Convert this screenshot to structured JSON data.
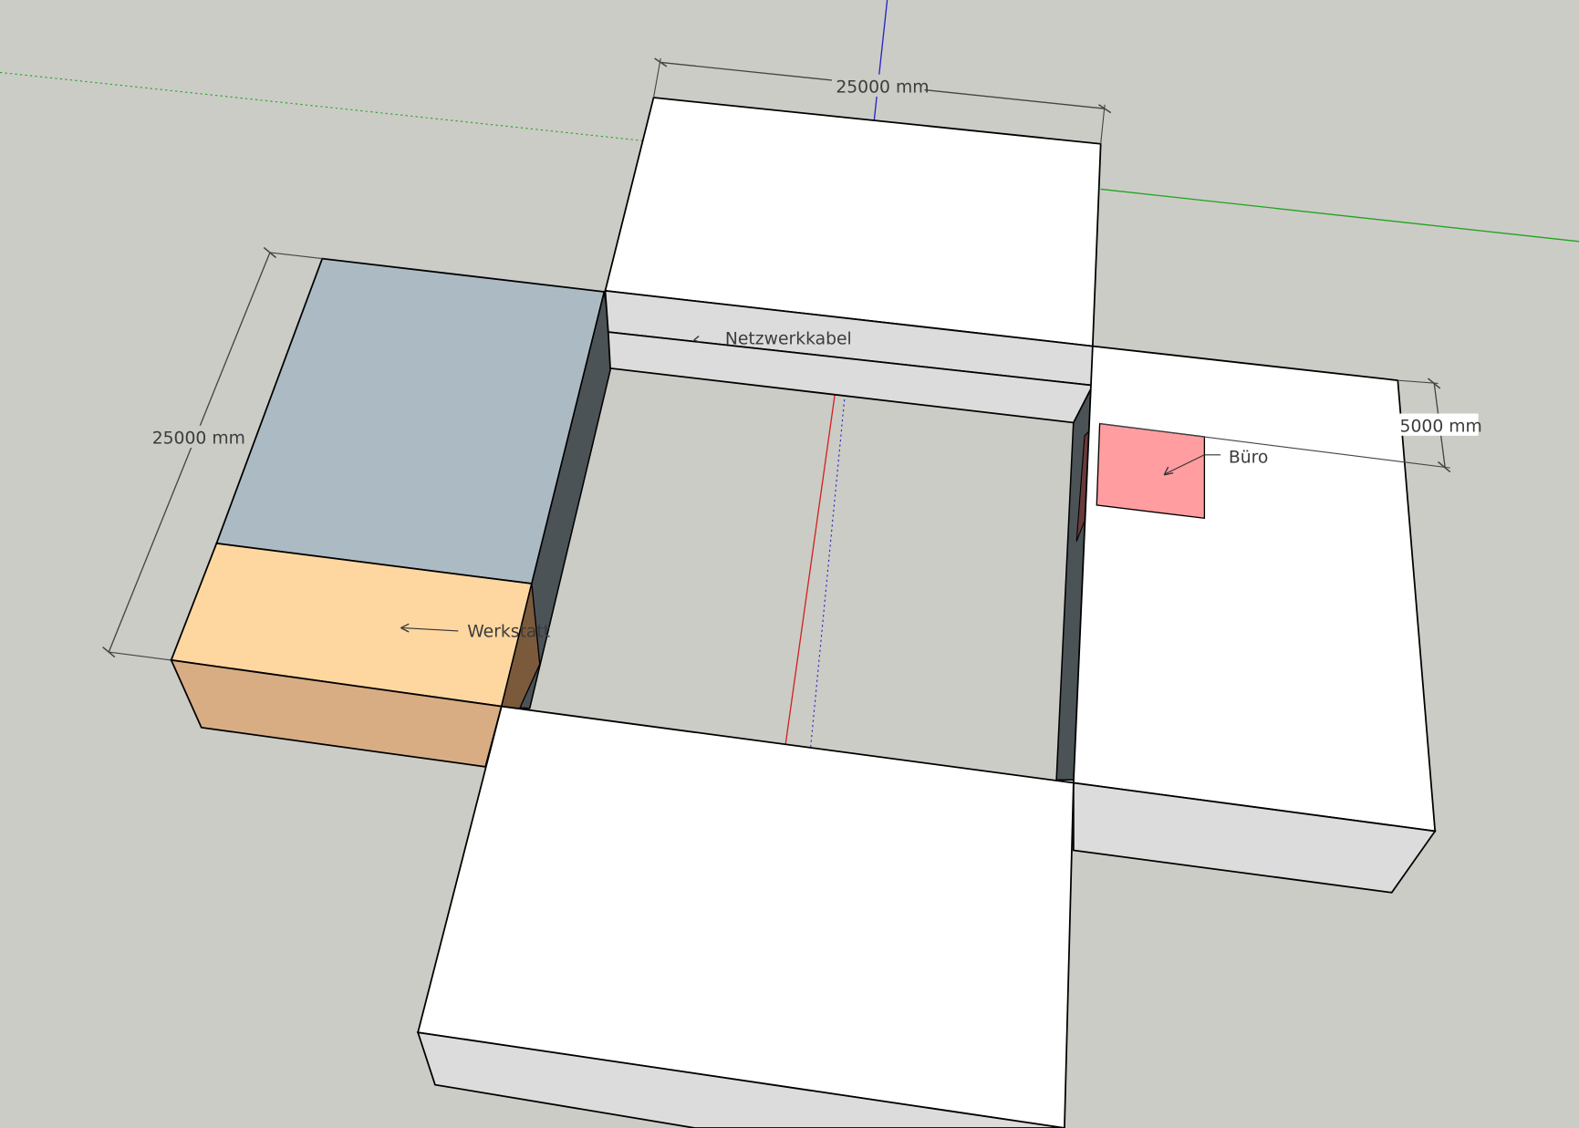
{
  "viewport": {
    "background": "#cbccc6"
  },
  "labels": {
    "netzwerkkabel": "Netzwerkkabel",
    "werkstatt": "Werkstatt",
    "buero": "Büro"
  },
  "dimensions": {
    "top_width": "25000 mm",
    "left_depth": "25000 mm",
    "right_small": "5000 mm"
  },
  "colors": {
    "wall_top": "#ffffff",
    "wall_side": "#dcdcdc",
    "shadow_side": "#4b5357",
    "werkstatt_top": "#fed7a0",
    "werkstatt_side": "#d8ad84",
    "storage_top": "#acbbc3",
    "buero_fill": "#ff9da0",
    "axis_red": "#d42020",
    "axis_green": "#1fa31f",
    "axis_blue": "#2424c8"
  },
  "icons": [
    "netzwerkkabel-leader-arrow-icon",
    "werkstatt-leader-arrow-icon",
    "buero-leader-arrow-icon",
    "dimension-tick-icon"
  ]
}
